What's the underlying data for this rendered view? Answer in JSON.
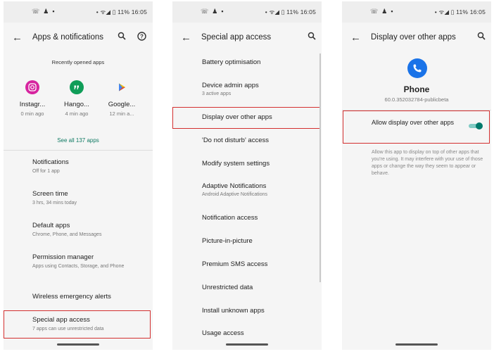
{
  "status": {
    "left_icons": [
      "☏",
      "♟",
      "▪"
    ],
    "right_text": "• ᯤ◢ ▯ 11% 16:05"
  },
  "colors": {
    "accent": "#0f7a63",
    "toggle_on": "#00796b",
    "highlight": "#d32f2f",
    "phone_icon": "#1a73e8"
  },
  "screen1": {
    "title": "Apps & notifications",
    "back_icon": "←",
    "search_icon": "⚲",
    "help_icon": "?",
    "recent_header": "Recently opened apps",
    "recent_apps": [
      {
        "name": "Instagr...",
        "time": "0 min ago",
        "icon": "instagram-icon",
        "glyph": "◎",
        "color": "#d6249f"
      },
      {
        "name": "Hango...",
        "time": "4 min ago",
        "icon": "hangouts-icon",
        "glyph": "❝",
        "color": "#0f9d58"
      },
      {
        "name": "Google...",
        "time": "12 min a...",
        "icon": "google-play-icon",
        "glyph": "▶",
        "color": "#34a853"
      }
    ],
    "see_all": "See all 137 apps",
    "settings": [
      {
        "title": "Notifications",
        "subtitle": "Off for 1 app"
      },
      {
        "title": "Screen time",
        "subtitle": "3 hrs, 34 mins today"
      },
      {
        "title": "Default apps",
        "subtitle": "Chrome, Phone, and Messages"
      },
      {
        "title": "Permission manager",
        "subtitle": "Apps using Contacts, Storage, and Phone"
      },
      {
        "title": "Wireless emergency alerts",
        "subtitle": ""
      },
      {
        "title": "Special app access",
        "subtitle": "7 apps can use unrestricted data"
      }
    ]
  },
  "screen2": {
    "title": "Special app access",
    "items": [
      {
        "title": "Battery optimisation",
        "subtitle": ""
      },
      {
        "title": "Device admin apps",
        "subtitle": "3 active apps"
      },
      {
        "title": "Display over other apps",
        "subtitle": ""
      },
      {
        "title": "'Do not disturb' access",
        "subtitle": ""
      },
      {
        "title": "Modify system settings",
        "subtitle": ""
      },
      {
        "title": "Adaptive Notifications",
        "subtitle": "Android Adaptive Notifications"
      },
      {
        "title": "Notification access",
        "subtitle": ""
      },
      {
        "title": "Picture-in-picture",
        "subtitle": ""
      },
      {
        "title": "Premium SMS access",
        "subtitle": ""
      },
      {
        "title": "Unrestricted data",
        "subtitle": ""
      },
      {
        "title": "Install unknown apps",
        "subtitle": ""
      },
      {
        "title": "Usage access",
        "subtitle": ""
      }
    ]
  },
  "screen3": {
    "title": "Display over other apps",
    "app_name": "Phone",
    "app_version": "60.0.352032784-publicbeta",
    "allow_label": "Allow display over other apps",
    "toggle_on": true,
    "description": "Allow this app to display on top of other apps that you're using. It may interfere with your use of those apps or change the way they seem to appear or behave."
  }
}
